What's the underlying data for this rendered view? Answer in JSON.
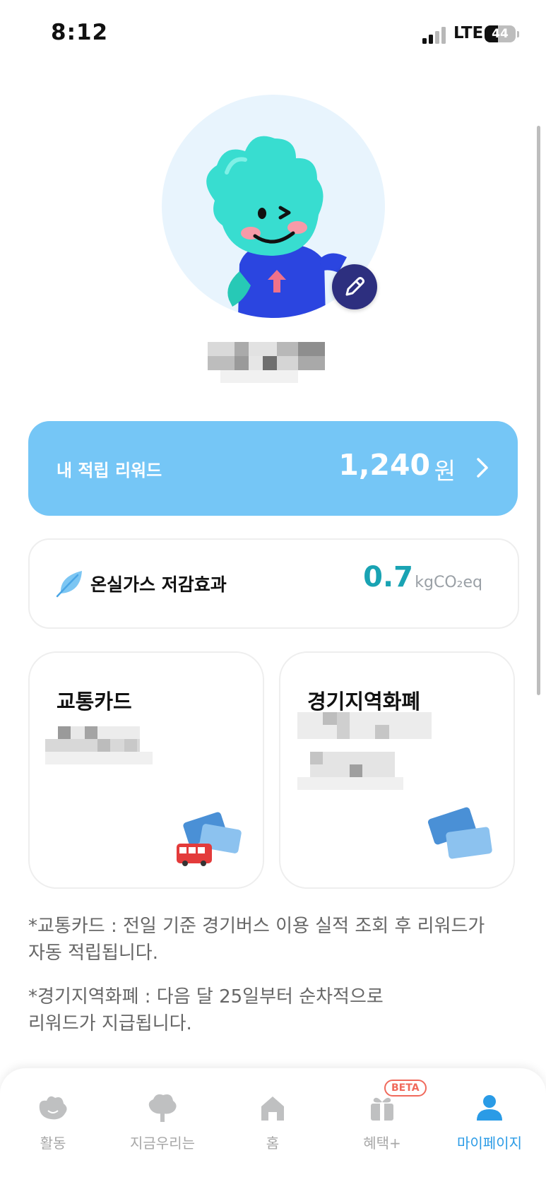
{
  "status_bar": {
    "time": "8:12",
    "network": "LTE",
    "battery": "44",
    "battery_fraction": 0.44
  },
  "profile": {
    "avatar_icon": "mascot-avatar",
    "edit_icon": "pencil-icon"
  },
  "reward": {
    "label": "내 적립 리워드",
    "amount": "1,240",
    "unit": "원",
    "chevron_icon": "chevron-right-icon"
  },
  "greenhouse": {
    "icon": "leaf-icon",
    "label": "온실가스 저감효과",
    "value": "0.7",
    "unit": "kgCO₂eq"
  },
  "cards": {
    "transit": {
      "title": "교통카드",
      "illustration": "bus-and-cards-illustration"
    },
    "local_currency": {
      "title": "경기지역화폐",
      "illustration": "cards-illustration"
    }
  },
  "notes": [
    "*교통카드 : 전일 기준 경기버스 이용 실적 조회 후 리워드가 자동 적립됩니다.",
    "*경기지역화폐 : 다음 달 25일부터 순차적으로 리워드가 지급됩니다."
  ],
  "notes_lines": [
    [
      "*교통카드 : 전일 기준 경기버스 이용 실적 조회 후 리워드가",
      "자동 적립됩니다."
    ],
    [
      "*경기지역화폐 : 다음 달 25일부터 순차적으로",
      "리워드가 지급됩니다."
    ]
  ],
  "nav": {
    "items": [
      {
        "label": "활동",
        "icon": "activity-mascot-icon"
      },
      {
        "label": "지금우리는",
        "icon": "tree-icon"
      },
      {
        "label": "홈",
        "icon": "home-icon"
      },
      {
        "label": "혜택+",
        "icon": "gift-icon",
        "badge": "BETA"
      },
      {
        "label": "마이페이지",
        "icon": "person-icon",
        "active": true
      }
    ]
  },
  "colors": {
    "reward_bg": "#75c6f6",
    "accent_blue": "#2a9be6",
    "co2_value": "#19a3b3",
    "edit_button": "#2d2f7f",
    "beta_badge": "#f06a5c"
  }
}
